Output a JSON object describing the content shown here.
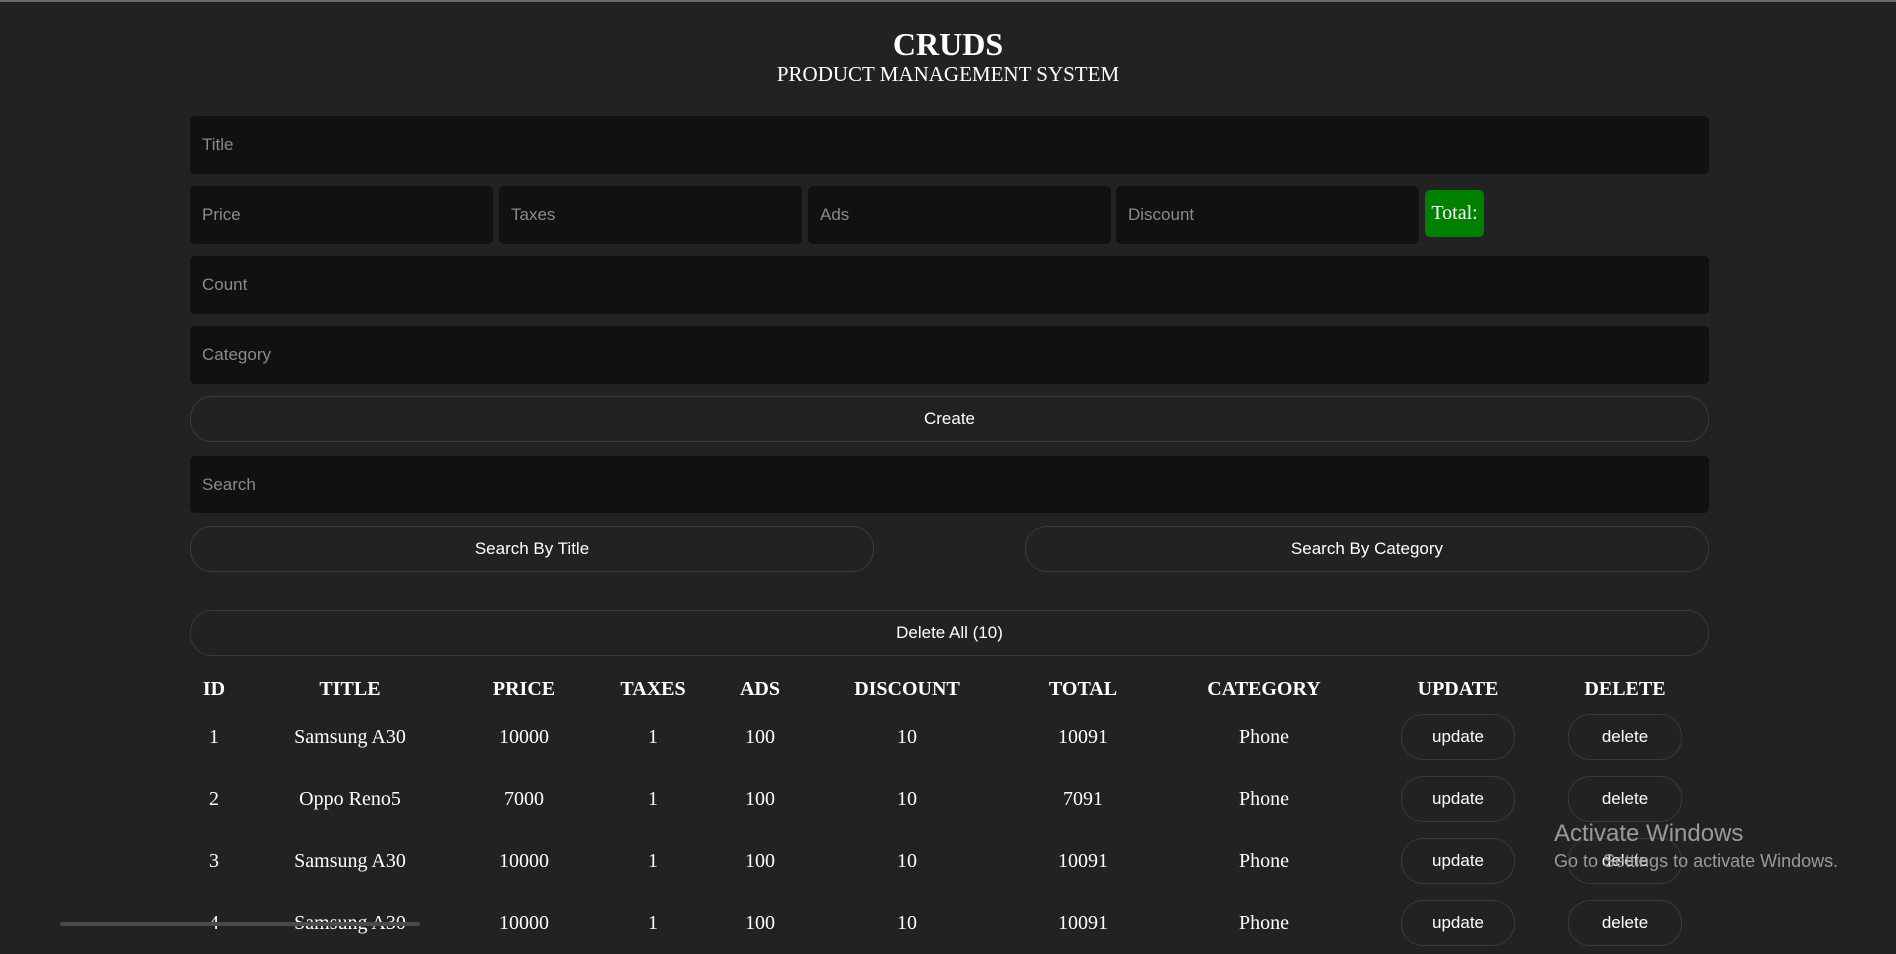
{
  "header": {
    "title": "CRUDS",
    "subtitle": "PRODUCT MANAGEMENT SYSTEM"
  },
  "form": {
    "title_placeholder": "Title",
    "price_placeholder": "Price",
    "taxes_placeholder": "Taxes",
    "ads_placeholder": "Ads",
    "discount_placeholder": "Discount",
    "total_label": "Total:",
    "total_color": "#008000",
    "count_placeholder": "Count",
    "category_placeholder": "Category",
    "create_label": "Create"
  },
  "search": {
    "placeholder": "Search",
    "by_title_label": "Search By Title",
    "by_category_label": "Search By Category"
  },
  "delete_all_label": "Delete All (10)",
  "table": {
    "headers": [
      "ID",
      "TITLE",
      "PRICE",
      "TAXES",
      "ADS",
      "DISCOUNT",
      "TOTAL",
      "CATEGORY",
      "UPDATE",
      "DELETE"
    ],
    "update_label": "update",
    "delete_label": "delete",
    "rows": [
      {
        "id": "1",
        "title": "Samsung A30",
        "price": "10000",
        "taxes": "1",
        "ads": "100",
        "discount": "10",
        "total": "10091",
        "category": "Phone"
      },
      {
        "id": "2",
        "title": "Oppo Reno5",
        "price": "7000",
        "taxes": "1",
        "ads": "100",
        "discount": "10",
        "total": "7091",
        "category": "Phone"
      },
      {
        "id": "3",
        "title": "Samsung A30",
        "price": "10000",
        "taxes": "1",
        "ads": "100",
        "discount": "10",
        "total": "10091",
        "category": "Phone"
      },
      {
        "id": "4",
        "title": "Samsung A30",
        "price": "10000",
        "taxes": "1",
        "ads": "100",
        "discount": "10",
        "total": "10091",
        "category": "Phone"
      }
    ]
  },
  "watermark": {
    "line1": "Activate Windows",
    "line2": "Go to Settings to activate Windows."
  }
}
